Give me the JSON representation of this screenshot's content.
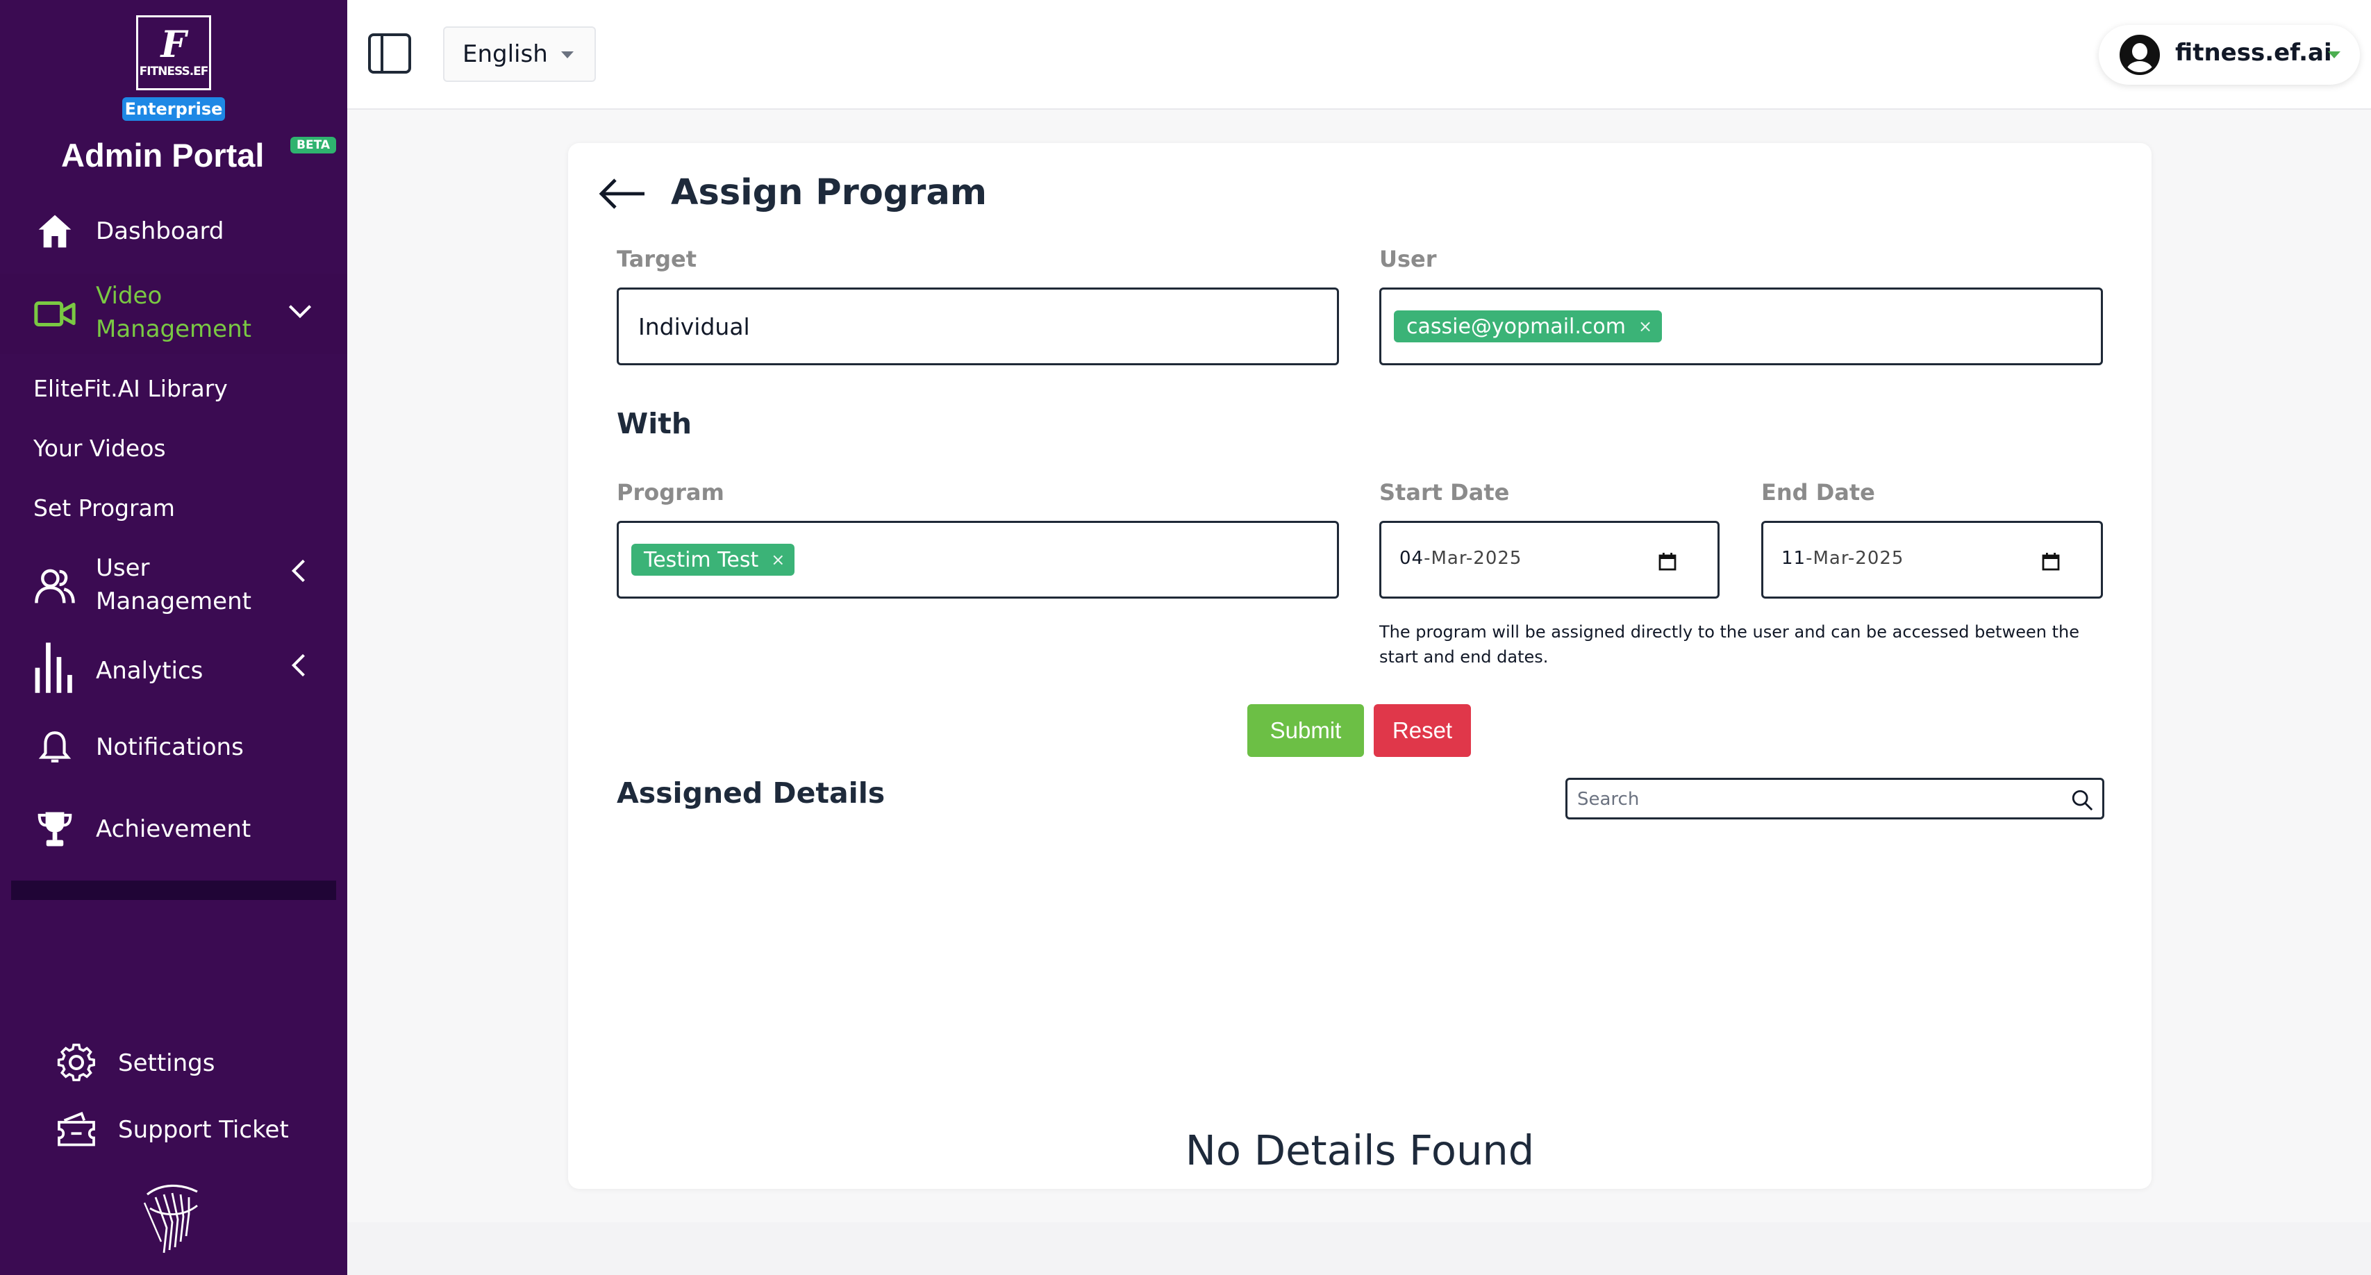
{
  "sidebar": {
    "logo_letter": "F",
    "logo_text": "FITNESS.EF",
    "plan_badge": "Enterprise",
    "title": "Admin Portal",
    "beta_badge": "BETA",
    "items": {
      "dashboard": "Dashboard",
      "video_management_line1": "Video",
      "video_management_line2": "Management",
      "user_management_line1": "User",
      "user_management_line2": "Management",
      "analytics": "Analytics",
      "notifications": "Notifications",
      "achievement": "Achievement"
    },
    "sub_items": {
      "library": "EliteFit.AI Library",
      "your_videos": "Your Videos",
      "set_program": "Set Program"
    },
    "bottom": {
      "settings": "Settings",
      "support": "Support Ticket"
    },
    "accent_color": "#7ac943",
    "background_color": "#3b0b52"
  },
  "topbar": {
    "language": "English",
    "profile_name": "fitness.ef.ai"
  },
  "card": {
    "title": "Assign Program",
    "target_label": "Target",
    "target_value": "Individual",
    "user_label": "User",
    "user_chip": "cassie@yopmail.com",
    "chip_remove": "×",
    "with_heading": "With",
    "program_label": "Program",
    "program_chip": "Testim Test",
    "start_date_label": "Start Date",
    "start_date": {
      "day": "04",
      "month": "Mar",
      "year": "2025"
    },
    "end_date_label": "End Date",
    "end_date": {
      "day": "11",
      "month": "Mar",
      "year": "2025"
    },
    "helper_text": "The program will be assigned directly to the user and can be accessed between the start and end dates.",
    "submit_label": "Submit",
    "reset_label": "Reset",
    "assigned_heading": "Assigned Details",
    "search_placeholder": "Search",
    "empty_message": "No Details Found"
  },
  "colors": {
    "chip": "#3bb377",
    "submit": "#6cbf45",
    "reset": "#e0374a",
    "enterprise": "#1e88e5"
  }
}
